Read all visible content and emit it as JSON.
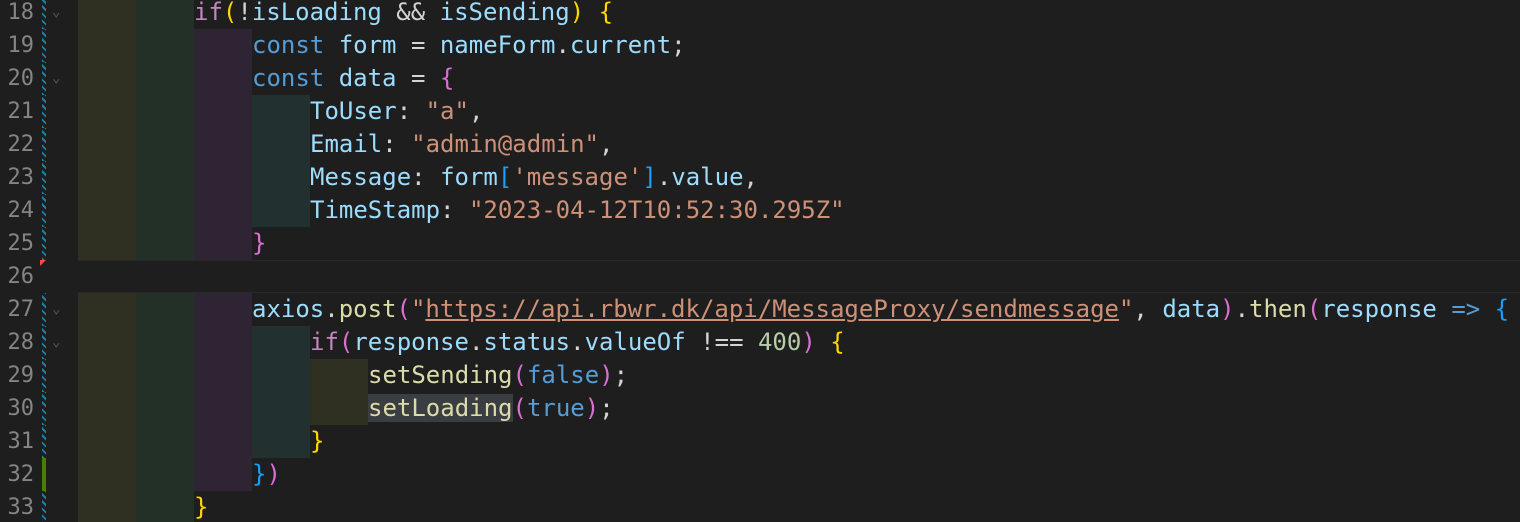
{
  "editor": {
    "lines": [
      {
        "n": "18"
      },
      {
        "n": "19"
      },
      {
        "n": "20"
      },
      {
        "n": "21"
      },
      {
        "n": "22"
      },
      {
        "n": "23"
      },
      {
        "n": "24"
      },
      {
        "n": "25"
      },
      {
        "n": "26"
      },
      {
        "n": "27"
      },
      {
        "n": "28"
      },
      {
        "n": "29"
      },
      {
        "n": "30"
      },
      {
        "n": "31"
      },
      {
        "n": "32"
      },
      {
        "n": "33"
      }
    ],
    "code": {
      "l18": {
        "if": "if",
        "p1": "(",
        "bang": "!",
        "isLoading": "isLoading",
        "and": " && ",
        "isSending": "isSending",
        "p2": ")",
        "sp": " ",
        "brace": "{"
      },
      "l19": {
        "const": "const",
        "form": " form",
        "eq": " = ",
        "nameForm": "nameForm",
        "dot": ".",
        "current": "current",
        "semi": ";"
      },
      "l20": {
        "const": "const",
        "data": " data",
        "eq": " = ",
        "brace": "{"
      },
      "l21": {
        "key": "ToUser",
        "colon": ": ",
        "val": "\"a\"",
        "comma": ","
      },
      "l22": {
        "key": "Email",
        "colon": ": ",
        "val": "\"admin@admin\"",
        "comma": ","
      },
      "l23": {
        "key": "Message",
        "colon": ": ",
        "form": "form",
        "b1": "[",
        "str": "'message'",
        "b2": "]",
        "dot": ".",
        "value": "value",
        "comma": ","
      },
      "l24": {
        "key": "TimeStamp",
        "colon": ": ",
        "val": "\"2023-04-12T10:52:30.295Z\""
      },
      "l25": {
        "brace": "}"
      },
      "l27": {
        "axios": "axios",
        "dot": ".",
        "post": "post",
        "p1": "(",
        "q1": "\"",
        "url": "https://api.rbwr.dk/api/MessageProxy/sendmessage",
        "q2": "\"",
        "comma": ", ",
        "data": "data",
        "p2": ")",
        "dot2": ".",
        "then": "then",
        "p3": "(",
        "response": "response",
        "arrow": " => ",
        "brace": "{"
      },
      "l28": {
        "if": "if",
        "p1": "(",
        "response": "response",
        "dot": ".",
        "status": "status",
        "dot2": ".",
        "valueOf": "valueOf",
        "neq": " !== ",
        "num": "400",
        "p2": ")",
        "sp": " ",
        "brace": "{"
      },
      "l29": {
        "fn": "setSending",
        "p1": "(",
        "val": "false",
        "p2": ")",
        "semi": ";"
      },
      "l30": {
        "fn": "setLoading",
        "p1": "(",
        "val": "true",
        "p2": ")",
        "semi": ";"
      },
      "l31": {
        "brace": "}"
      },
      "l32": {
        "brace": "}",
        "paren": ")"
      },
      "l33": {
        "brace": "}"
      }
    }
  }
}
